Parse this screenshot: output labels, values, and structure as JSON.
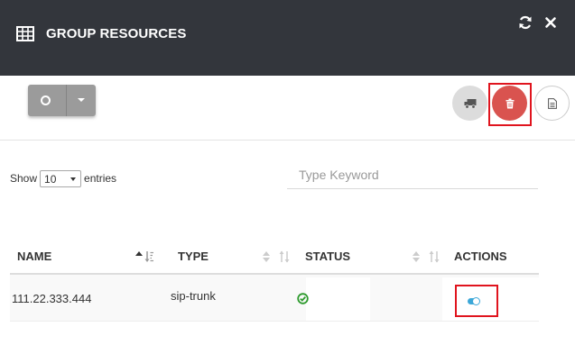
{
  "modal": {
    "title": "GROUP RESOURCES",
    "icons": {
      "title": "table-grid-icon",
      "refresh": "refresh-icon",
      "close": "close-icon"
    }
  },
  "toolbar": {
    "split_button_icon": "circle-outline-icon",
    "dropdown_icon": "caret-down-icon",
    "buttons": [
      {
        "icon": "truck-icon",
        "color": "#dcdcdc"
      },
      {
        "icon": "trash-icon",
        "color": "#d9534f"
      },
      {
        "icon": "document-icon",
        "color": "#ffffff"
      }
    ]
  },
  "table_controls": {
    "show_label": "Show",
    "entries_value": "10",
    "entries_label": "entries",
    "search_placeholder": "Type Keyword"
  },
  "table": {
    "columns": [
      "NAME",
      "TYPE",
      "STATUS",
      "ACTIONS"
    ],
    "rows": [
      {
        "name": "111.22.333.444",
        "type": "sip-trunk",
        "status_icon": "check-circle-icon",
        "action_icon": "toggle-on-icon"
      }
    ]
  },
  "colors": {
    "header_bg": "#33363c",
    "delete": "#d9534f",
    "status_ok": "#2e9b2e",
    "toggle": "#3ba7d8",
    "highlight": "#e0141e"
  }
}
